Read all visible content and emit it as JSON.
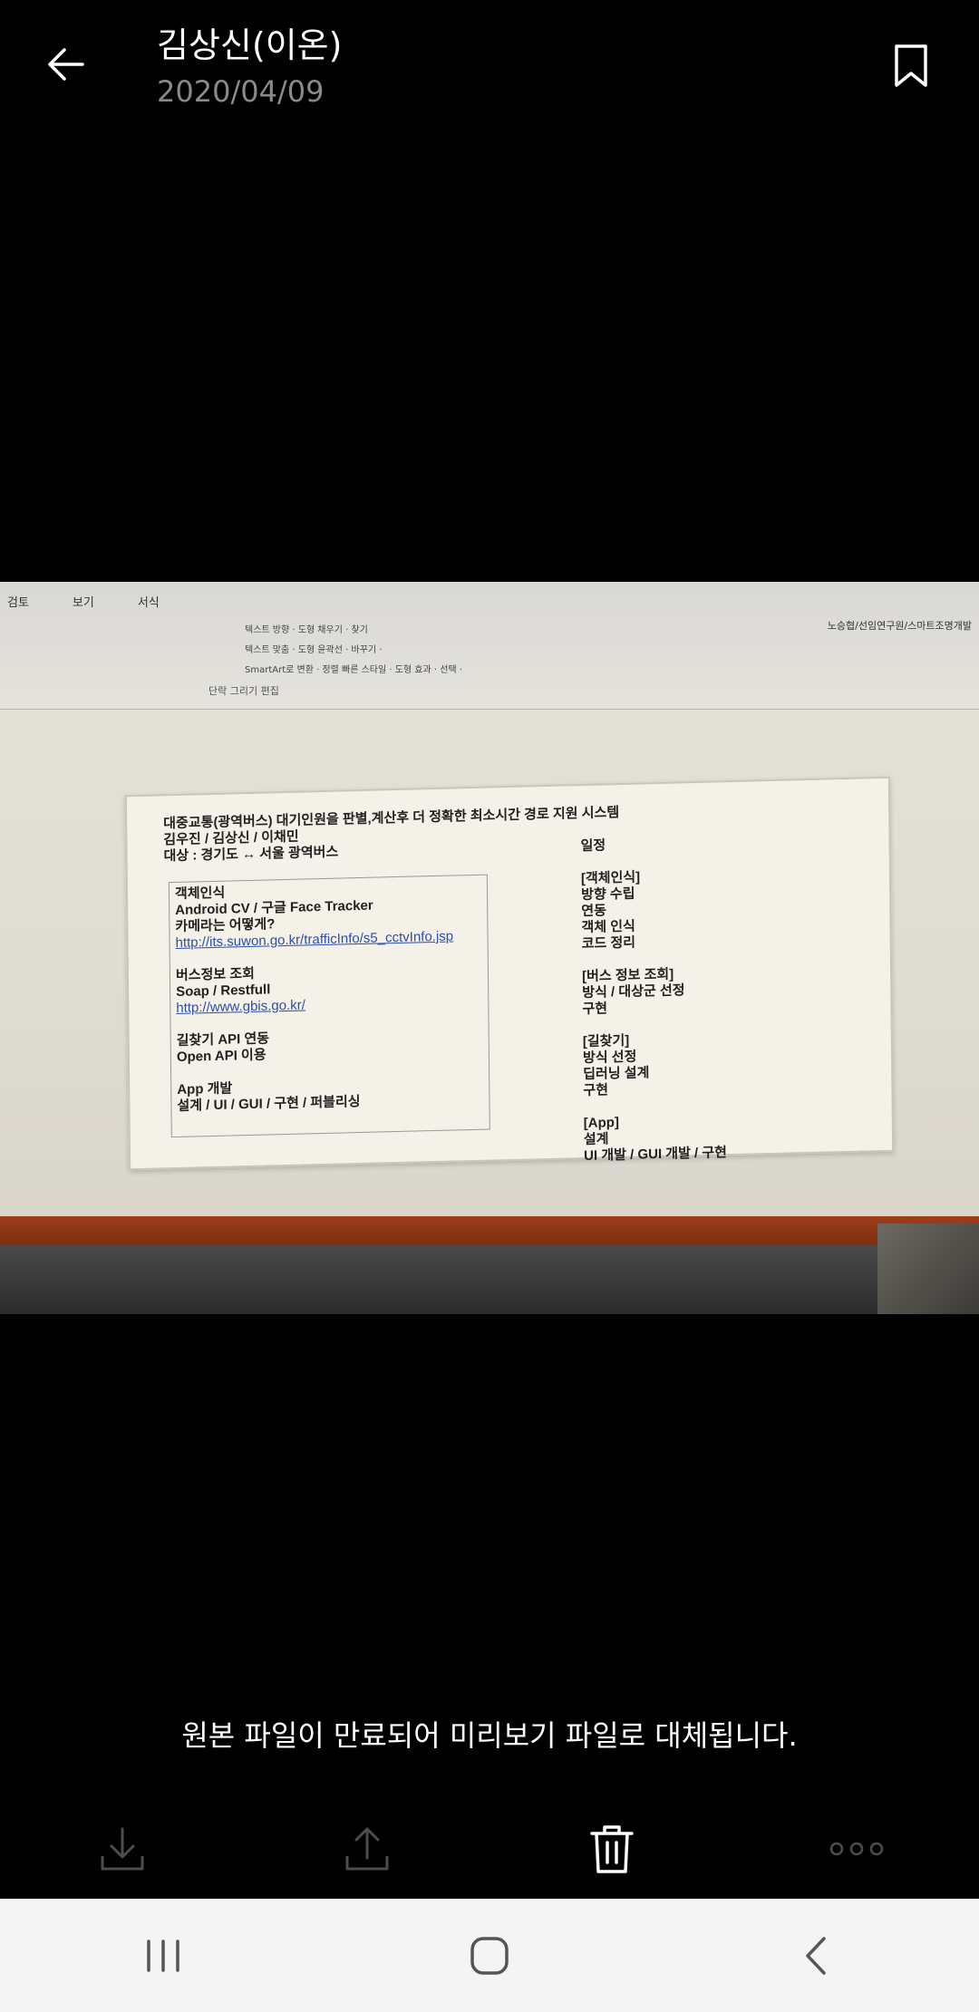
{
  "header": {
    "sender_name": "김상신(이온)",
    "date": "2020/04/09",
    "back_icon": "arrow-left-icon",
    "bookmark_icon": "bookmark-icon"
  },
  "photo": {
    "ribbon": {
      "menu": [
        "검토",
        "보기",
        "서식"
      ],
      "right_path": "노승협/선임연구원/스마트조명개발",
      "row1": "텍스트 방향 ·   도형 채우기 ·   찾기",
      "row2": "텍스트 맞춤 ·   도형 윤곽선 ·   바꾸기 ·",
      "row3": "SmartArt로 변환 ·   정렬   빠른 스타일 ·   도형 효과 ·   선택 ·",
      "group_labels": "단락          그리기          편집"
    },
    "slide": {
      "title": "대중교통(광역버스) 대기인원을 판별,계산후 더 정확한 최소시간 경로 지원 시스템",
      "members": "김우진 / 김상신 / 이채민",
      "target": "대상 : 경기도 ↔ 서울 광역버스",
      "left_column": [
        "객체인식",
        "Android CV / 구글 Face Tracker",
        "카메라는 어떻게?"
      ],
      "link1": "http://its.suwon.go.kr/trafficInfo/s5_cctvInfo.jsp",
      "bus_section": [
        "버스정보 조회",
        "Soap / Restfull"
      ],
      "link2": "http://www.gbis.go.kr/",
      "route_section": [
        "길찾기 API 연동",
        "Open API 이용"
      ],
      "app_section": [
        "App 개발",
        "설계 / UI / GUI / 구현 / 퍼블리싱"
      ],
      "schedule_title": "일정",
      "schedule": [
        "[객체인식]",
        "방향 수립",
        "연동",
        "객체 인식",
        "코드 정리",
        "",
        "[버스 정보 조회]",
        "방식 / 대상군 선정",
        "구현",
        "",
        "[길찾기]",
        "방식 선정",
        "딥러닝 설계",
        "구현",
        "",
        "[App]",
        "설계",
        "UI 개발      / GUI 개발      / 구현"
      ]
    }
  },
  "notice": "원본 파일이 만료되어 미리보기 파일로 대체됩니다.",
  "actions": [
    {
      "icon": "download-icon"
    },
    {
      "icon": "share-icon"
    },
    {
      "icon": "trash-icon"
    },
    {
      "icon": "more-icon"
    }
  ],
  "navbar": [
    {
      "icon": "recent-apps-icon"
    },
    {
      "icon": "home-icon"
    },
    {
      "icon": "back-icon"
    }
  ]
}
